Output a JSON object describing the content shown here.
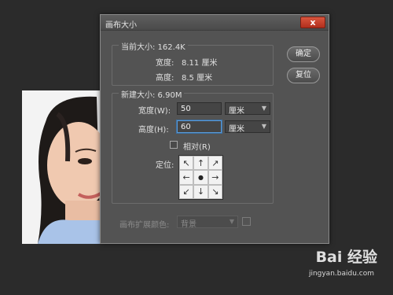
{
  "dialog": {
    "title": "画布大小",
    "close_label": "x",
    "current": {
      "label": "当前大小: 162.4K",
      "width_label": "宽度:",
      "width_value": "8.11 厘米",
      "height_label": "高度:",
      "height_value": "8.5 厘米"
    },
    "new": {
      "label": "新建大小: 6.90M",
      "width_label": "宽度(W):",
      "width_value": "50",
      "width_unit": "厘米",
      "height_label": "高度(H):",
      "height_value": "60",
      "height_unit": "厘米",
      "relative_label": "相对(R)",
      "anchor_label": "定位:"
    },
    "anchor_arrows": [
      "↖",
      "↑",
      "↗",
      "←",
      "●",
      "→",
      "↙",
      "↓",
      "↘"
    ],
    "ok_label": "确定",
    "reset_label": "复位",
    "extension_color_label": "画布扩展颜色:",
    "extension_color_value": "背景"
  },
  "watermark": {
    "logo": "Bai 经验",
    "url": "jingyan.baidu.com"
  },
  "colors": {
    "dialog_bg": "#535353",
    "close_button": "#c43f2a",
    "workspace_bg": "#2b2b2b"
  }
}
